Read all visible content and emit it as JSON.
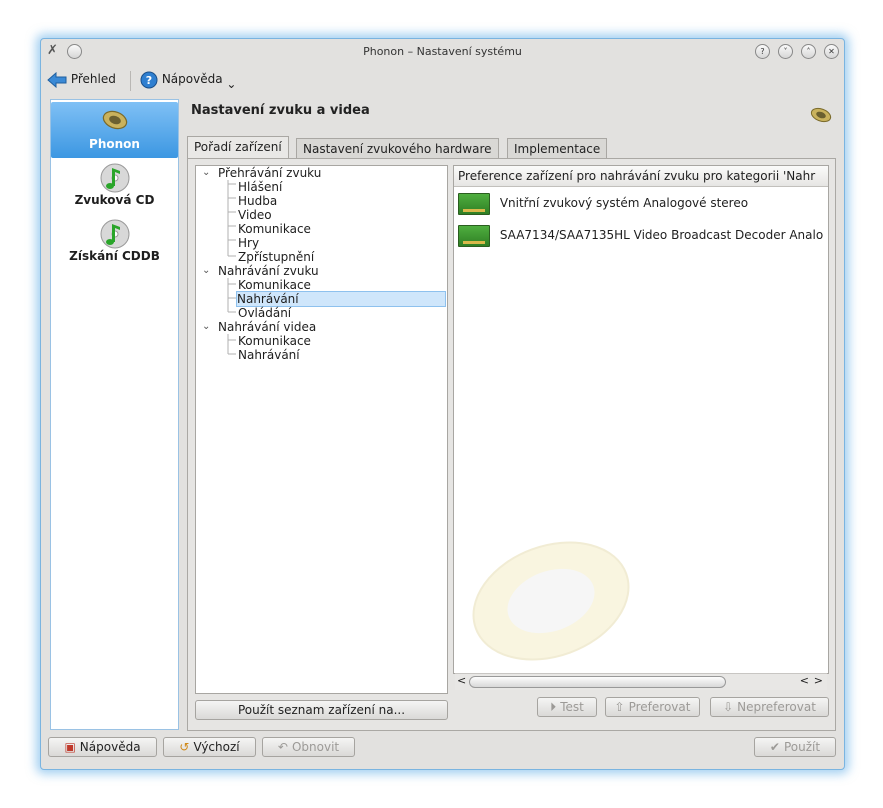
{
  "window": {
    "title": "Phonon – Nastavení systému",
    "controls": [
      "?",
      "˅",
      "˄",
      "✕"
    ]
  },
  "toolbar": {
    "overview_label": "Přehled",
    "help_label": "Nápověda",
    "help_dropdown": "⌄"
  },
  "sidebar": {
    "items": [
      {
        "label": "Phonon",
        "icon": "speaker-icon",
        "selected": true
      },
      {
        "label": "Zvuková CD",
        "icon": "music-cd-icon",
        "selected": false
      },
      {
        "label": "Získání CDDB",
        "icon": "music-cd-icon",
        "selected": false
      }
    ]
  },
  "content": {
    "title": "Nastavení zvuku a videa",
    "tabs": [
      {
        "label": "Pořadí zařízení",
        "active": true
      },
      {
        "label": "Nastavení zvukového hardware",
        "active": false
      },
      {
        "label": "Implementace",
        "active": false
      }
    ]
  },
  "tree": {
    "groups": [
      {
        "label": "Přehrávání zvuku",
        "children": [
          "Hlášení",
          "Hudba",
          "Video",
          "Komunikace",
          "Hry",
          "Zpřístupnění"
        ]
      },
      {
        "label": "Nahrávání zvuku",
        "children": [
          "Komunikace",
          "Nahrávání",
          "Ovládání"
        ]
      },
      {
        "label": "Nahrávání videa",
        "children": [
          "Komunikace",
          "Nahrávání"
        ]
      }
    ],
    "selected": "Nahrávání zvuku / Nahrávání"
  },
  "preference": {
    "header": "Preference zařízení pro nahrávání zvuku pro kategorii 'Nahr",
    "devices": [
      "Vnitřní zvukový systém Analogové stereo",
      "SAA7134/SAA7135HL Video Broadcast Decoder Analo"
    ]
  },
  "buttons": {
    "apply_list": "Použít seznam zařízení na...",
    "test": "Test",
    "prefer": "Preferovat",
    "unprefer": "Nepreferovat"
  },
  "bottom": {
    "help": "Nápověda",
    "default": "Výchozí",
    "reset": "Obnovit",
    "apply": "Použít"
  },
  "colors": {
    "accent": "#3c97e2",
    "selection": "#cfe6fb",
    "window_bg": "#e2e1df"
  }
}
